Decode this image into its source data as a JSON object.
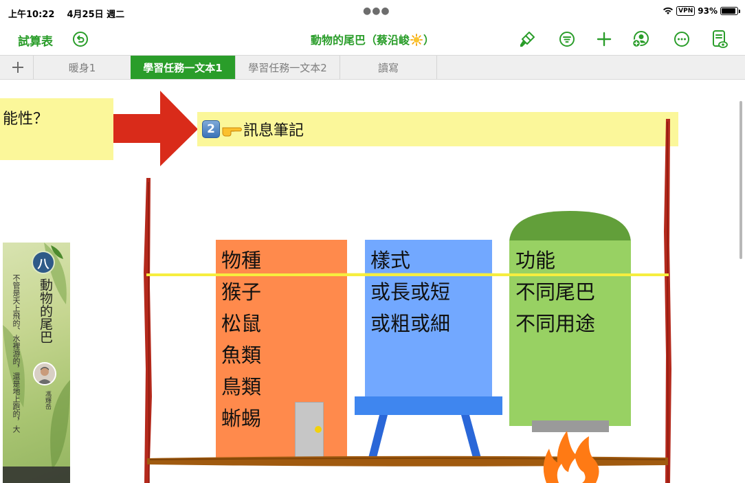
{
  "status_bar": {
    "time": "上午10:22",
    "date": "4月25日 週二",
    "vpn": "VPN",
    "battery": "93%",
    "battery_level": 0.93
  },
  "toolbar": {
    "sheet_label": "試算表",
    "doc_title": "動物的尾巴（蔡沿峻",
    "doc_title_suffix": "）"
  },
  "tabs": [
    {
      "label": "暖身1",
      "active": false
    },
    {
      "label": "學習任務一文本1",
      "active": true
    },
    {
      "label": "學習任務一文本2",
      "active": false
    },
    {
      "label": "讀寫",
      "active": false
    }
  ],
  "canvas": {
    "left_note": "能性？",
    "top_note_badge": "2",
    "top_note": "訊息筆記",
    "columns": [
      {
        "header": "物種",
        "items": [
          "猴子",
          "松鼠",
          "魚類",
          "鳥類",
          "蜥蜴"
        ]
      },
      {
        "header": "樣式",
        "items": [
          "或長或短",
          "或粗或細"
        ]
      },
      {
        "header": "功能",
        "items": [
          "不同尾巴",
          "不同用途"
        ]
      }
    ],
    "book": {
      "badge": "八",
      "title": "動物的尾巴",
      "vertical_text": "不管是天上飛的、水裡游的，還是地上跑的，大",
      "author": "馮輝岳"
    }
  },
  "colors": {
    "accent": "#2a9d2a",
    "note_yellow": "#fbf79a",
    "arrow_red": "#d92b1a",
    "orange_shape": "#ff8a4c",
    "blue_shape": "#72a8ff",
    "green_shape": "#98d163",
    "green_dome": "#629f3a"
  }
}
